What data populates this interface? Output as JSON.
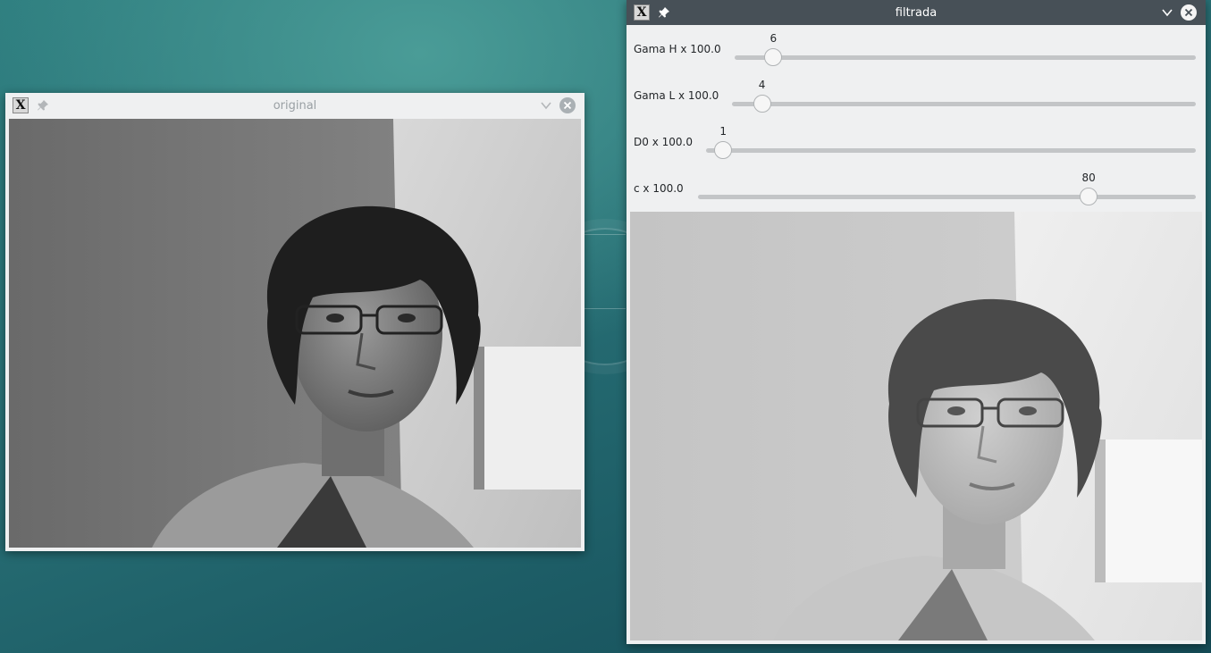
{
  "windows": {
    "original": {
      "title": "original",
      "state": "inactive"
    },
    "filtrada": {
      "title": "filtrada",
      "state": "active",
      "trackbars": [
        {
          "label": "Gama H x 100.0",
          "value": 6,
          "max": 100
        },
        {
          "label": "Gama L x 100.0",
          "value": 4,
          "max": 100
        },
        {
          "label": "D0 x 100.0",
          "value": 1,
          "max": 100
        },
        {
          "label": "c x 100.0",
          "value": 80,
          "max": 100
        }
      ]
    }
  },
  "icons": {
    "app": "x11-app-icon",
    "pin": "pin-icon",
    "minimize": "chevron-down-icon",
    "close": "close-icon"
  },
  "colors": {
    "active_titlebar": "#475057",
    "window_bg": "#eff0f1",
    "desktop": "#2a7378"
  }
}
